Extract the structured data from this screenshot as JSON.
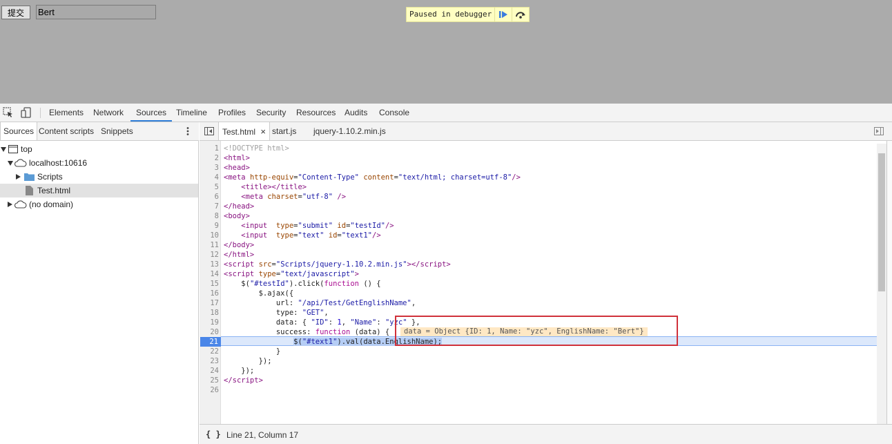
{
  "page": {
    "submit_label": "提交",
    "input_value": "Bert",
    "paused_text": "Paused in debugger",
    "resume_icon": "resume-icon",
    "step_over_icon": "step-over-icon"
  },
  "toolbar": {
    "tabs": [
      "Elements",
      "Network",
      "Sources",
      "Timeline",
      "Profiles",
      "Security",
      "Resources",
      "Audits",
      "Console"
    ],
    "active_tab": "Sources"
  },
  "navigator": {
    "tabs": [
      "Sources",
      "Content scripts",
      "Snippets"
    ],
    "tree": [
      "top",
      "localhost:10616",
      "Scripts",
      "Test.html",
      "(no domain)"
    ]
  },
  "editor": {
    "tabs": [
      "Test.html",
      "start.js",
      "jquery-1.10.2.min.js"
    ],
    "close_glyph": "×",
    "inline_value": "data = Object {ID: 1, Name: \"yzc\", EnglishName: \"Bert\"}",
    "exec_line": 21
  },
  "status": {
    "pretty_print": "{ }",
    "cursor": "Line 21, Column 17"
  },
  "colors": {
    "accent": "#2f7ed8",
    "highlight_box": "#d0303a",
    "exec_line": "#dce8fb",
    "breakpoint": "#4a86e8"
  }
}
